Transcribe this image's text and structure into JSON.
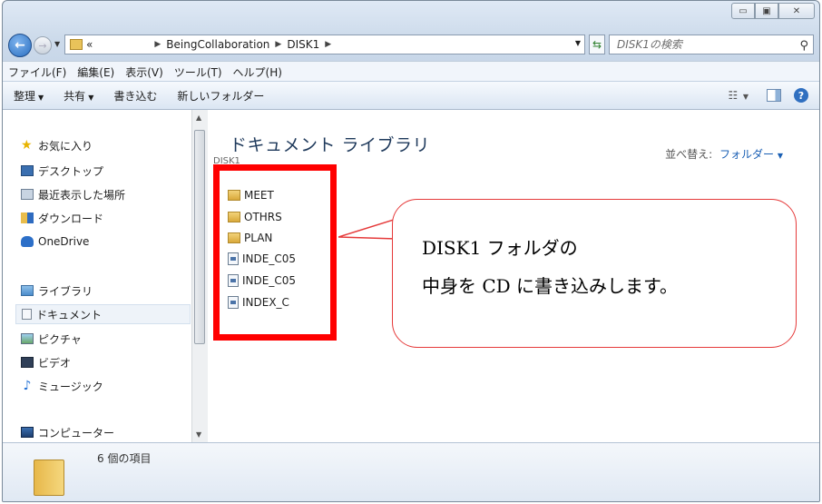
{
  "window": {
    "controls": {
      "minimize": "▭",
      "maximize": "▣",
      "close": "✕"
    }
  },
  "address": {
    "overflow": "«",
    "segments": [
      "BeingCollaboration",
      "DISK1"
    ],
    "search_placeholder": "DISK1の検索"
  },
  "menu": [
    "ファイル(F)",
    "編集(E)",
    "表示(V)",
    "ツール(T)",
    "ヘルプ(H)"
  ],
  "toolbar": {
    "organize": "整理",
    "share": "共有",
    "burn": "書き込む",
    "new_folder": "新しいフォルダー",
    "views": "☷"
  },
  "nav": {
    "favorites_header": "お気に入り",
    "favorites": [
      "デスクトップ",
      "最近表示した場所",
      "ダウンロード",
      "OneDrive"
    ],
    "libraries_header": "ライブラリ",
    "libraries": [
      "ドキュメント",
      "ピクチャ",
      "ビデオ",
      "ミュージック"
    ],
    "computer": "コンピューター"
  },
  "content": {
    "title": "ドキュメント ライブラリ",
    "subtitle": "DISK1",
    "sort_label": "並べ替え:",
    "sort_value": "フォルダー",
    "files": [
      {
        "name": "MEET",
        "type": "folder"
      },
      {
        "name": "OTHRS",
        "type": "folder"
      },
      {
        "name": "PLAN",
        "type": "folder"
      },
      {
        "name": "INDE_C05",
        "type": "file"
      },
      {
        "name": "INDE_C05",
        "type": "file"
      },
      {
        "name": "INDEX_C",
        "type": "file"
      }
    ]
  },
  "callout": {
    "line1": "DISK1 フォルダの",
    "line2": "中身を CD に書き込みします。",
    "border_color": "#e53939",
    "frame_color": "#ff0000"
  },
  "details": {
    "item_count": "6 個の項目"
  }
}
